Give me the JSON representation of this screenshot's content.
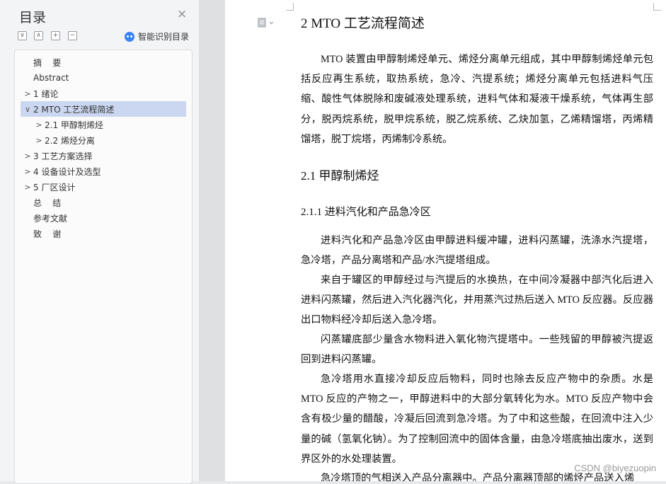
{
  "toc": {
    "title": "目录",
    "close": "×",
    "buttons": [
      "∨",
      "∧",
      "+",
      "−"
    ],
    "smart_label": "智能识别目录",
    "items": [
      {
        "label": "摘    要",
        "chevron": "",
        "active": false
      },
      {
        "label": "Abstract",
        "chevron": "",
        "active": false
      },
      {
        "label": "1 绪论",
        "chevron": ">",
        "active": false
      },
      {
        "label": "2 MTO 工艺流程简述",
        "chevron": "∨",
        "active": true
      },
      {
        "label": "2.1 甲醇制烯烃",
        "chevron": ">",
        "active": false
      },
      {
        "label": "2.2 烯烃分离",
        "chevron": ">",
        "active": false
      },
      {
        "label": "3 工艺方案选择",
        "chevron": ">",
        "active": false
      },
      {
        "label": "4 设备设计及选型",
        "chevron": ">",
        "active": false
      },
      {
        "label": "5 厂区设计",
        "chevron": ">",
        "active": false
      },
      {
        "label": "总    结",
        "chevron": "",
        "active": false
      },
      {
        "label": "参考文献",
        "chevron": "",
        "active": false
      },
      {
        "label": "致    谢",
        "chevron": "",
        "active": false
      }
    ]
  },
  "document": {
    "h1": "2 MTO 工艺流程简述",
    "p1": "MTO 装置由甲醇制烯烃单元、烯烃分离单元组成，其中甲醇制烯烃单元包括反应再生系统，取热系统，急冷、汽提系统；烯烃分离单元包括进料气压缩、酸性气体脱除和废碱液处理系统，进料气体和凝液干燥系统，气体再生部分，脱丙烷系统，脱甲烷系统，脱乙烷系统、乙炔加氢，乙烯精馏塔，丙烯精馏塔，脱丁烷塔，丙烯制冷系统。",
    "h2": "2.1 甲醇制烯烃",
    "h3": "2.1.1 进料汽化和产品急冷区",
    "p2": "进料汽化和产品急冷区由甲醇进料缓冲罐，进料闪蒸罐，洗涤水汽提塔，急冷塔，产品分离塔和产品/水汽提塔组成。",
    "p3": "来自于罐区的甲醇经过与汽提后的水换热，在中间冷凝器中部汽化后进入进料闪蒸罐，然后进入汽化器汽化，并用蒸汽过热后送入 MTO 反应器。反应器出口物料经冷却后送入急冷塔。",
    "p4": "闪蒸罐底部少量含水物料进入氧化物汽提塔中。一些残留的甲醇被汽提返回到进料闪蒸罐。",
    "p5": "急冷塔用水直接冷却反应后物料，同时也除去反应产物中的杂质。水是 MTO 反应的产物之一，甲醇进料中的大部分氧转化为水。MTO 反应产物中会含有极少量的醋酸，冷凝后回流到急冷塔。为了中和这些酸，在回流中注入少量的碱（氢氧化钠）。为了控制回流中的固体含量，由急冷塔底抽出废水，送到界区外的水处理装置。",
    "p6": "急冷塔顶的气相送入产品分离器中。产品分离器顶部的烯烃产品送入烯"
  },
  "watermark": "CSDN @biyezuopin"
}
